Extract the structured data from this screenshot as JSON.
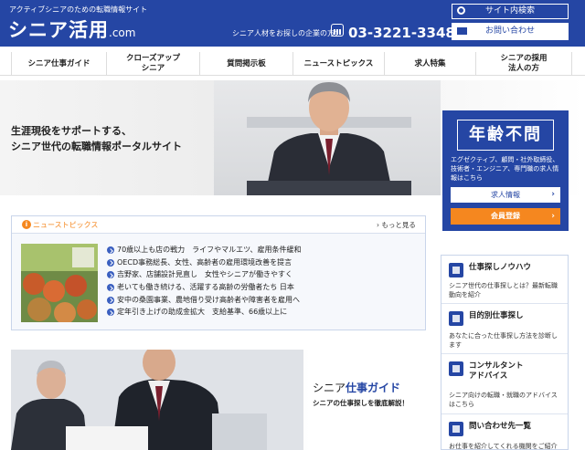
{
  "header": {
    "tagline": "アクティブシニアのための転職情報サイト",
    "logo_main": "シニア活用",
    "logo_domain": ".com",
    "contact_label": "シニア人材をお探しの企業の方：",
    "phone": "03-3221-3348",
    "search_label": "サイト内検索",
    "contact_label_btn": "お問い合わせ"
  },
  "nav": {
    "items": [
      {
        "label": "シニア仕事ガイド"
      },
      {
        "label": "クローズアップ\nシニア"
      },
      {
        "label": "質問掲示板"
      },
      {
        "label": "ニューストピックス"
      },
      {
        "label": "求人特集"
      },
      {
        "label": "シニアの採用\n法人の方"
      }
    ]
  },
  "hero": {
    "line1": "生涯現役をサポートする、",
    "line2": "シニア世代の転職情報ポータルサイト"
  },
  "age_box": {
    "title": "年齢不問",
    "desc": "エグゼクティブ、顧問・社外取締役、技術者・エンジニア、専門職の求人情報はこちら",
    "job_btn": "求人情報",
    "register_btn": "会員登録"
  },
  "news": {
    "title": "ニューストピックス",
    "more": "もっと見る",
    "items": [
      "70歳以上も店の戦力　ライフやマルエツ、雇用条件緩和",
      "OECD事務総長、女性、高齢者の雇用環境改善を提言",
      "吉野家、店舗設計見直し　女性やシニアが働きやすく",
      "老いても働き続ける、活躍する高齢の労働者たち 日本",
      "安中の桑園事業、農地借り受け高齢者や障害者を雇用へ",
      "定年引き上げの助成金拡大　支給基準、66歳以上に"
    ]
  },
  "guide": {
    "title_a": "シニア",
    "title_b": "仕事ガイド",
    "sub": "シニアの仕事探しを徹底解説！"
  },
  "side": {
    "items": [
      {
        "title": "仕事探しノウハウ",
        "desc": "シニア世代の仕事探しとは？最新転職動向を紹介"
      },
      {
        "title": "目的別仕事探し",
        "desc": "あなたに合った仕事探し方法を診断します"
      },
      {
        "title": "コンサルタント\nアドバイス",
        "desc": "シニア向けの転職・就職のアドバイスはこちら"
      },
      {
        "title": "問い合わせ先一覧",
        "desc": "お仕事を紹介してくれる機関をご紹介"
      }
    ]
  },
  "colors": {
    "brand": "#2546a4",
    "accent": "#f5871f"
  }
}
